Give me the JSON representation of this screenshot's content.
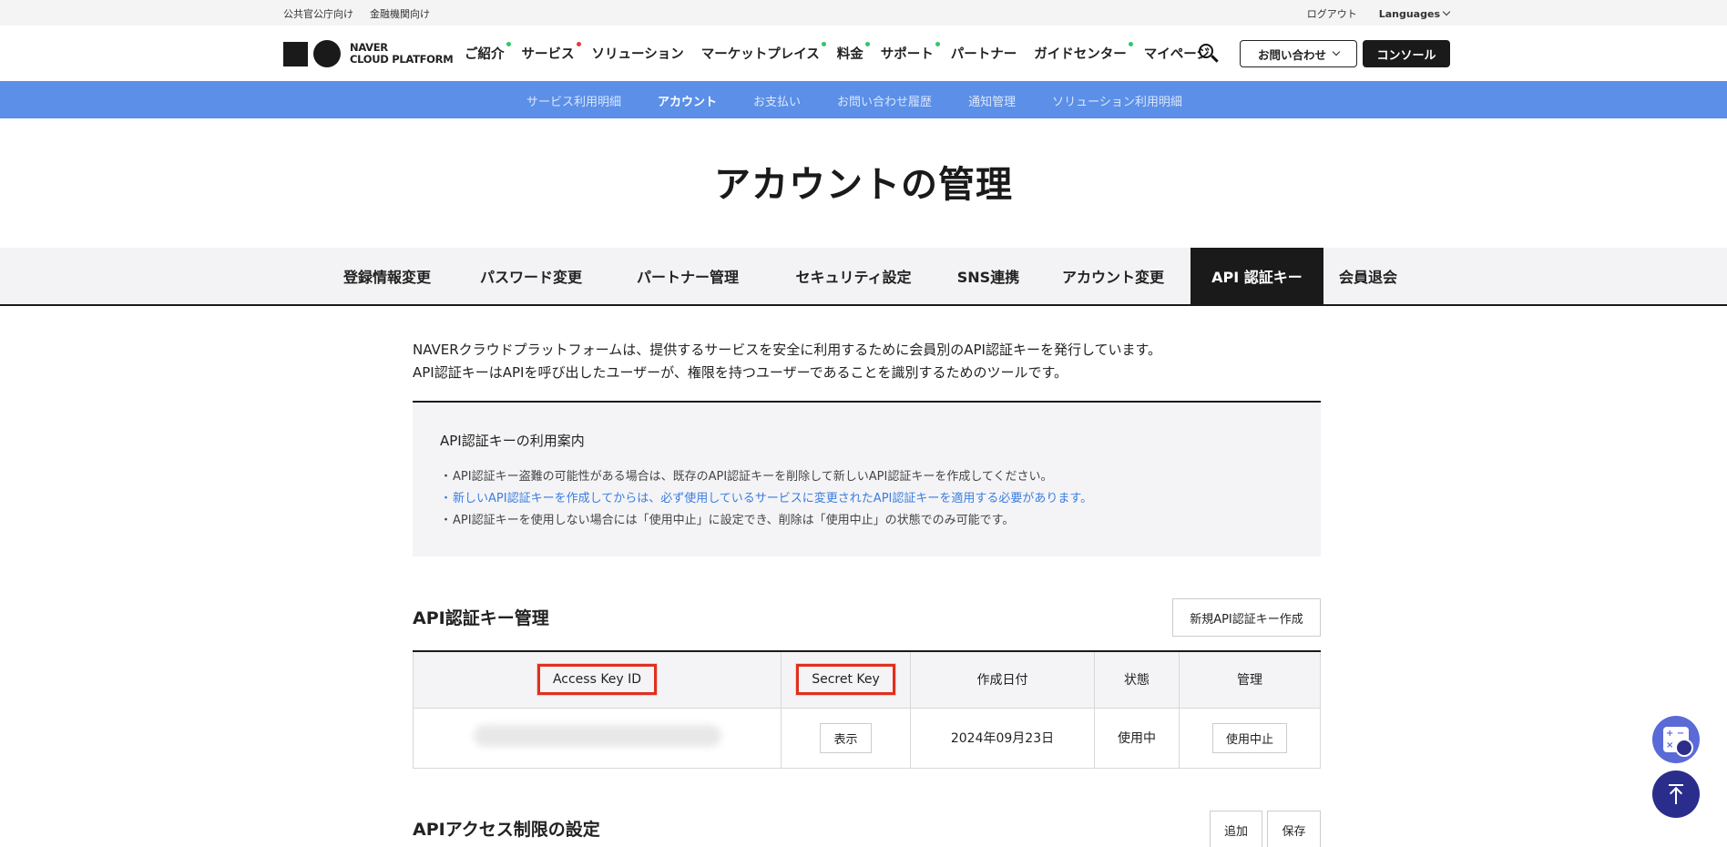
{
  "util": {
    "left": [
      "公共官公庁向け",
      "金融機関向け"
    ],
    "logout": "ログアウト",
    "languages": "Languages"
  },
  "header": {
    "logo_line1": "NAVER",
    "logo_line2": "CLOUD PLATFORM",
    "nav": [
      {
        "label": "ご紹介",
        "dot": "#35c46a"
      },
      {
        "label": "サービス",
        "dot": "#e03c3c"
      },
      {
        "label": "ソリューション",
        "dot": ""
      },
      {
        "label": "マーケットプレイス",
        "dot": "#35c46a"
      },
      {
        "label": "料金",
        "dot": "#35c46a"
      },
      {
        "label": "サポート",
        "dot": "#35c46a"
      },
      {
        "label": "パートナー",
        "dot": ""
      },
      {
        "label": "ガイドセンター",
        "dot": "#35c46a"
      },
      {
        "label": "マイページ",
        "dot": ""
      }
    ],
    "contact": "お問い合わせ",
    "console": "コンソール"
  },
  "subnav": [
    "サービス利用明細",
    "アカウント",
    "お支払い",
    "お問い合わせ履歴",
    "通知管理",
    "ソリューション利用明細"
  ],
  "page_title": "アカウントの管理",
  "tabs": [
    "登録情報変更",
    "パスワード変更",
    "パートナー管理",
    "セキュリティ設定",
    "SNS連携",
    "アカウント変更",
    "API 認証キー",
    "会員退会"
  ],
  "intro": {
    "line1": "NAVERクラウドプラットフォームは、提供するサービスを安全に利用するために会員別のAPI認証キーを発行しています。",
    "line2": "API認証キーはAPIを呼び出したユーザーが、権限を持つユーザーであることを識別するためのツールです。"
  },
  "guide": {
    "title": "API認証キーの利用案内",
    "items": [
      "API認証キー盗難の可能性がある場合は、既存のAPI認証キーを削除して新しいAPI認証キーを作成してください。",
      "新しいAPI認証キーを作成してからは、必ず使用しているサービスに変更されたAPI認証キーを適用する必要があります。",
      "API認証キーを使用しない場合には「使用中止」に設定でき、削除は「使用中止」の状態でのみ可能です。"
    ]
  },
  "keymgmt": {
    "title": "API認証キー管理",
    "create_btn": "新規API認証キー作成",
    "headers": [
      "Access Key ID",
      "Secret Key",
      "作成日付",
      "状態",
      "管理"
    ],
    "row": {
      "show": "表示",
      "date": "2024年09月23日",
      "status": "使用中",
      "action": "使用中止"
    }
  },
  "access": {
    "title": "APIアクセス制限の設定",
    "add": "追加",
    "save": "保存"
  }
}
